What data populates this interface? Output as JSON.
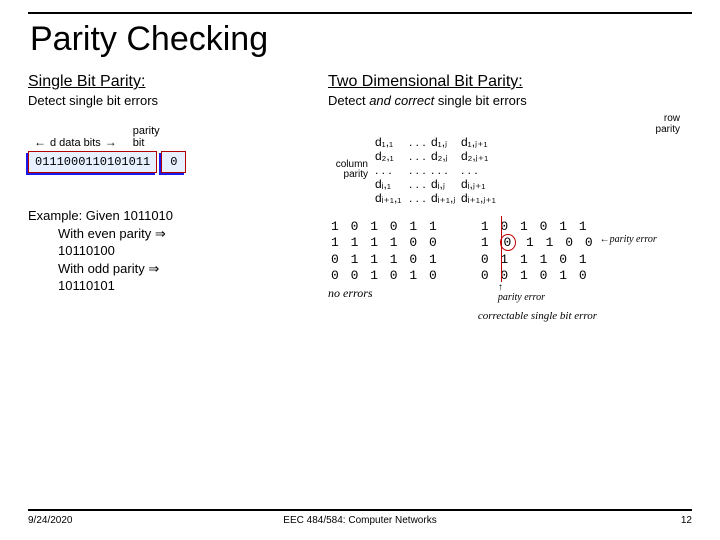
{
  "title": "Parity Checking",
  "left": {
    "head": "Single Bit Parity:",
    "sub": "Detect single bit errors",
    "dlabel": "d data bits",
    "plabel_1": "parity",
    "plabel_2": "bit",
    "bits": "0111000110101011",
    "pbit": "0"
  },
  "example": {
    "line1": "Example: Given 1011010",
    "line2": "With even parity ⇒",
    "line3": "10110100",
    "line4": "With odd parity ⇒",
    "line5": "10110101"
  },
  "right": {
    "head": "Two Dimensional Bit Parity:",
    "sub_pre": "Detect ",
    "sub_em": "and correct",
    "sub_post": " single bit errors",
    "rowparity_1": "row",
    "rowparity_2": "parity",
    "colparity_1": "column",
    "colparity_2": "parity"
  },
  "matrix": {
    "r1c1": "d₁,₁",
    "r1c2": ". . .",
    "r1c3": "d₁,ⱼ",
    "r1c4": "d₁,ⱼ₊₁",
    "r2c1": "d₂,₁",
    "r2c2": ". . .",
    "r2c3": "d₂,ⱼ",
    "r2c4": "d₂,ⱼ₊₁",
    "r3c1": ". . .",
    "r3c2": ". . .",
    "r3c3": ". . .",
    "r3c4": ". . .",
    "r4c1": "dᵢ,₁",
    "r4c2": ". . .",
    "r4c3": "dᵢ,ⱼ",
    "r4c4": "dᵢ,ⱼ₊₁",
    "r5c1": "dᵢ₊₁,₁",
    "r5c2": ". . .",
    "r5c3": "dᵢ₊₁,ⱼ",
    "r5c4": "dᵢ₊₁,ⱼ₊₁"
  },
  "bits_left": {
    "r1": "1 0 1 0 1  1",
    "r2": "1 1 1 1 0  0",
    "r3": "0 1 1 1 0  1",
    "r4": "0 0 1 0 1  0",
    "cap": "no errors"
  },
  "bits_right": {
    "r1": "1 0 1 0 1  1",
    "r2a": "1 ",
    "r2b": "0",
    "r2c": " 1 1 0  0",
    "r3": "0 1 1 1 0  1",
    "r4": "0 0 1 0 1  0",
    "pe": "parity error",
    "pe2": "parity error",
    "corr": "correctable single bit error"
  },
  "footer": {
    "left": "9/24/2020",
    "mid": "EEC 484/584: Computer Networks",
    "right": "12"
  }
}
